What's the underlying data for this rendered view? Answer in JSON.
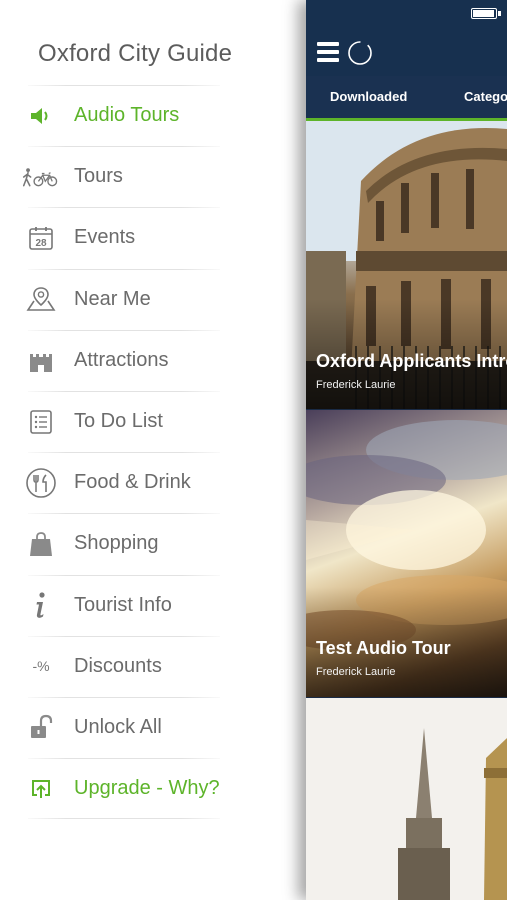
{
  "menu": {
    "title": "Oxford City Guide",
    "accent_color": "#5db42a",
    "text_color": "#6b6b6b",
    "items": [
      {
        "label": "Audio Tours",
        "icon": "speaker-icon",
        "highlighted": true
      },
      {
        "label": "Tours",
        "icon": "walker-bicycle-icon",
        "highlighted": false
      },
      {
        "label": "Events",
        "icon": "calendar-icon",
        "highlighted": false
      },
      {
        "label": "Near Me",
        "icon": "map-pin-icon",
        "highlighted": false
      },
      {
        "label": "Attractions",
        "icon": "castle-icon",
        "highlighted": false
      },
      {
        "label": "To Do List",
        "icon": "checklist-icon",
        "highlighted": false
      },
      {
        "label": "Food & Drink",
        "icon": "fork-knife-icon",
        "highlighted": false
      },
      {
        "label": "Shopping",
        "icon": "shopping-bag-icon",
        "highlighted": false
      },
      {
        "label": "Tourist Info",
        "icon": "info-icon",
        "highlighted": false
      },
      {
        "label": "Discounts",
        "icon": "percent-icon",
        "highlighted": false
      },
      {
        "label": "Unlock All",
        "icon": "padlock-icon",
        "highlighted": false
      },
      {
        "label": "Upgrade - Why?",
        "icon": "upgrade-icon",
        "highlighted": true
      }
    ]
  },
  "calendar_day": "28",
  "discount_symbol": "-%",
  "app": {
    "navbar_color": "#17304f",
    "tabs": [
      {
        "label": "Downloaded",
        "active": true
      },
      {
        "label": "Categories",
        "active": false
      }
    ],
    "cards": [
      {
        "title": "Oxford Applicants Introduction",
        "author": "Frederick Laurie"
      },
      {
        "title": "Test Audio Tour",
        "author": "Frederick Laurie"
      },
      {
        "title": "",
        "author": ""
      }
    ]
  }
}
